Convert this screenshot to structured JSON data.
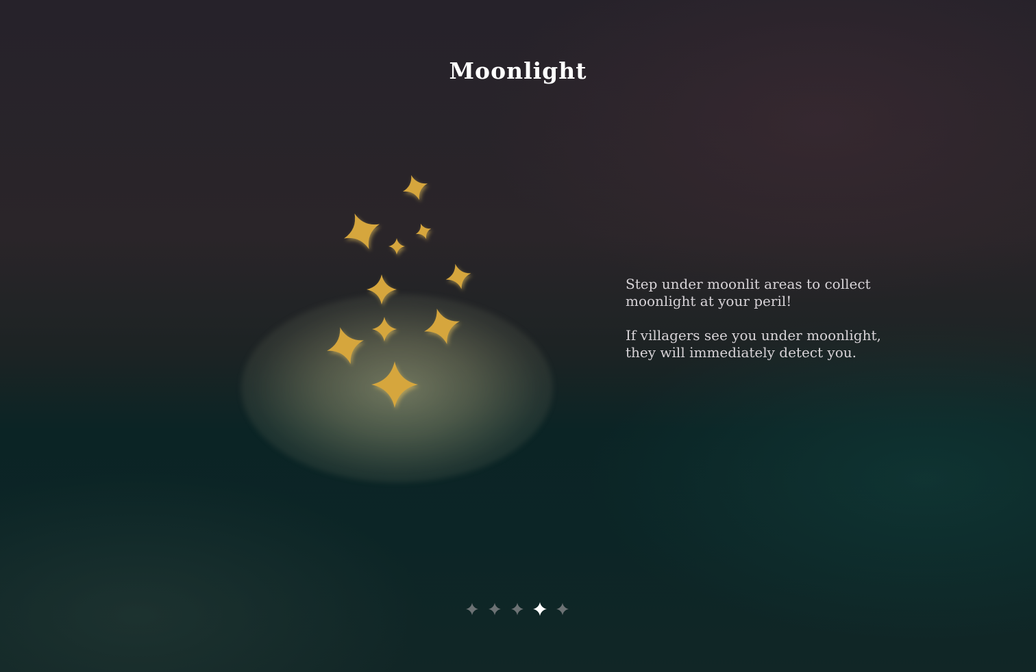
{
  "screen": {
    "title": "Moonlight",
    "description": [
      "Step under moonlit areas to collect moonlight at your peril!",
      "If villagers see you under moonlight, they will immediately detect you."
    ]
  },
  "illustration": {
    "icon": "moonlight-sparkles-icon",
    "sparkle_color": "#d6a63e",
    "glow_color": "#a8a882"
  },
  "pagination": {
    "total": 5,
    "current": 4,
    "active_color": "#ffffff",
    "inactive_color": "#6c7274"
  }
}
